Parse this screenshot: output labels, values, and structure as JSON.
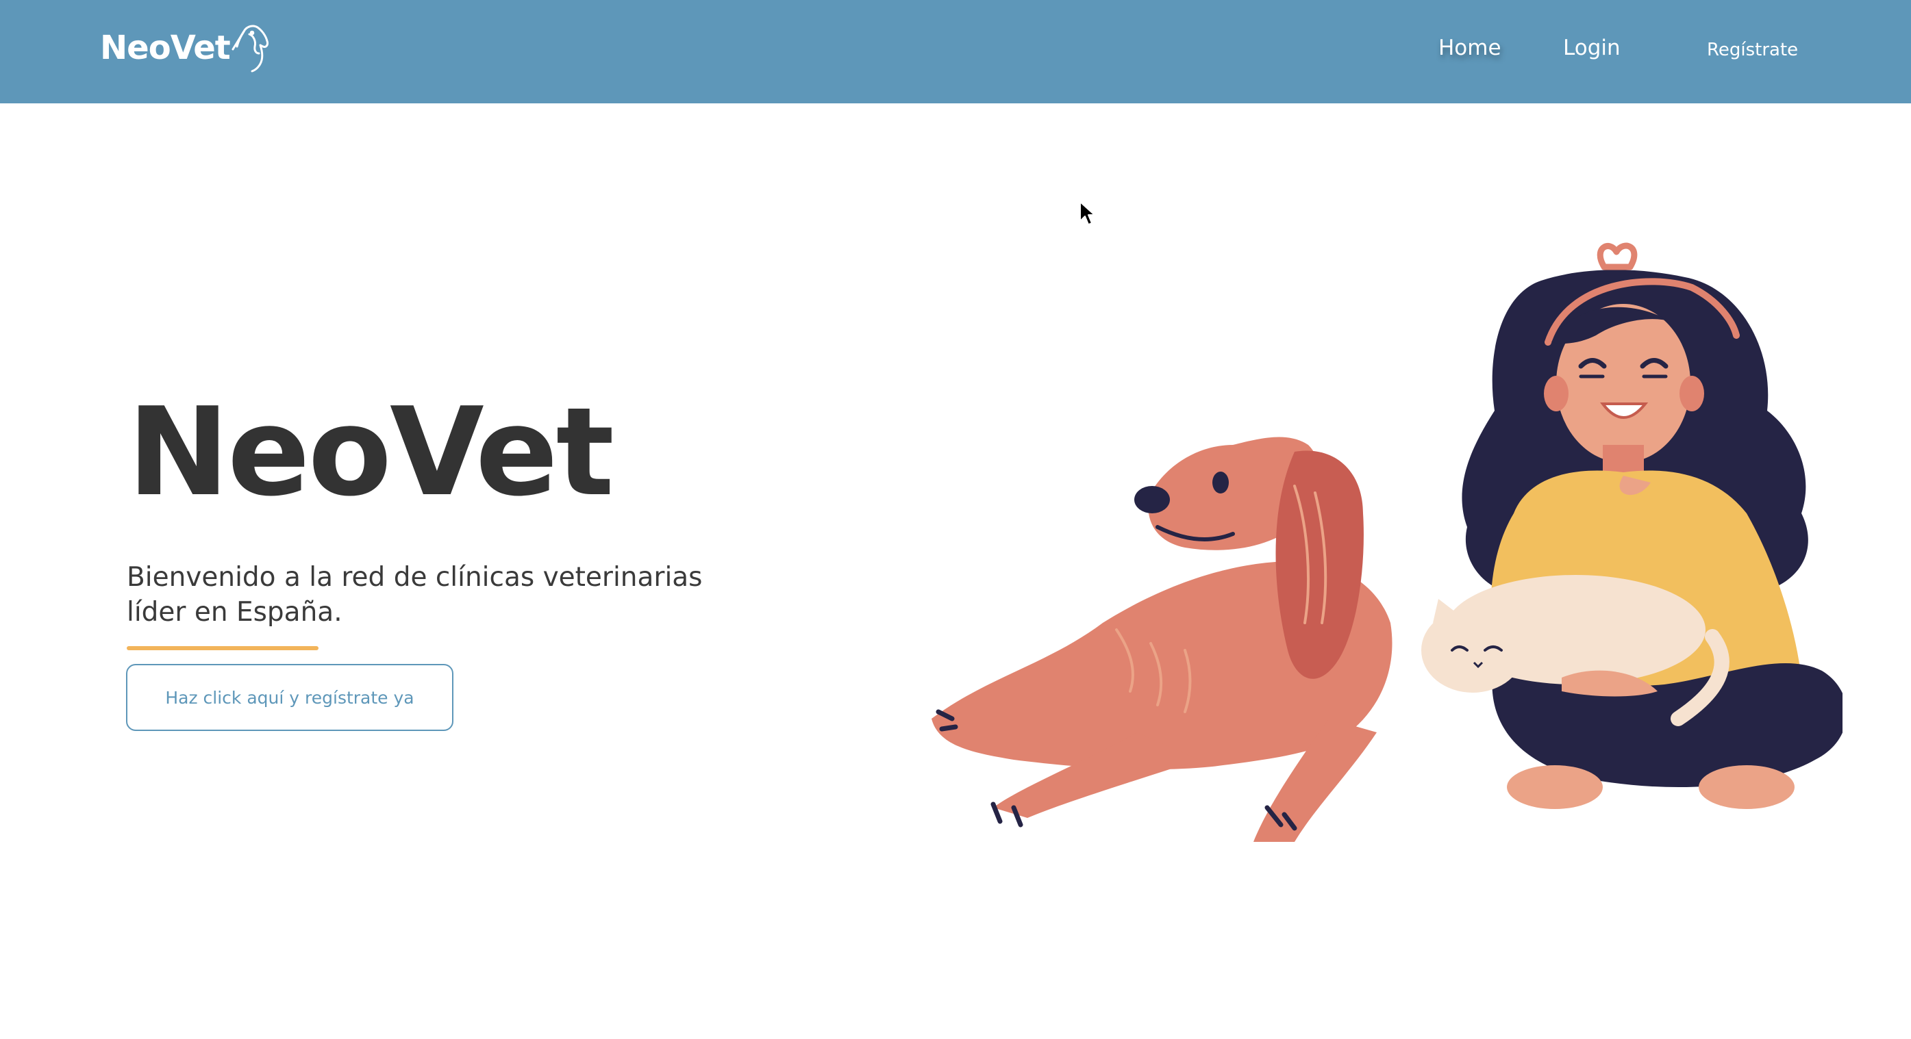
{
  "header": {
    "brand": "NeoVet",
    "nav": {
      "home": "Home",
      "login": "Login",
      "register": "Regístrate"
    }
  },
  "hero": {
    "title": "NeoVet",
    "subtitle": "Bienvenido a la red de clínicas veterinarias líder en España.",
    "cta": "Haz click aquí y regístrate ya"
  },
  "colors": {
    "navbar": "#5e97b9",
    "title_text": "#333333",
    "accent_underline": "#f2b45a",
    "button_border": "#5e97b9"
  },
  "icons": {
    "brand_logo": "dog-head-icon",
    "cursor": "mouse-cursor-icon"
  }
}
